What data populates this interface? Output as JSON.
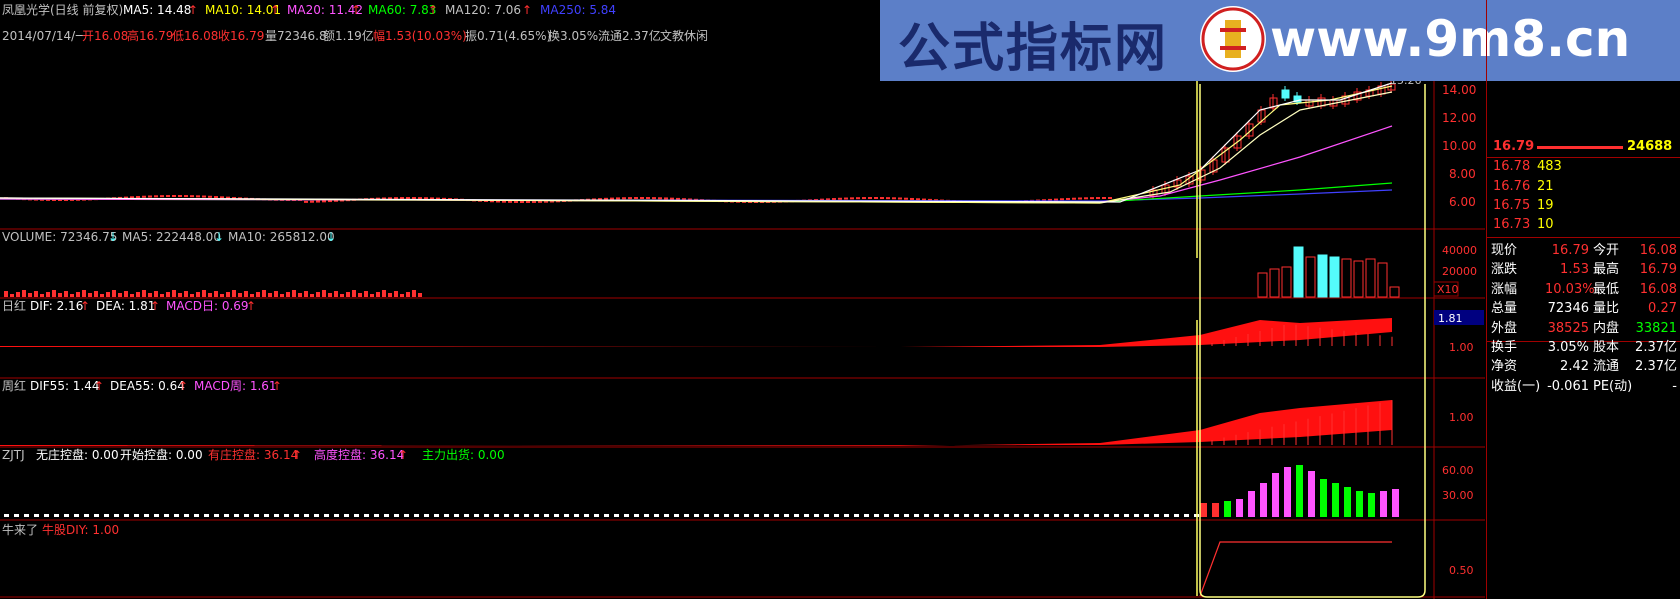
{
  "colors": {
    "up": "#ff3030",
    "down": "#54fcfc",
    "yellow": "#ffff00",
    "white": "#ffffff",
    "magenta": "#ff54ff",
    "green": "#00ff00",
    "grid": "#a00000",
    "gray": "#c0c0c0"
  },
  "header": {
    "stock": "凤凰光学(日线 前复权)",
    "ma5": "MA5: 14.48",
    "ma10": "MA10: 14.01",
    "ma20": "MA20: 11.42",
    "ma60": "MA60: 7.83",
    "ma120": "MA120: 7.06",
    "ma250": "MA250: 5.84",
    "date": "2014/07/14/一",
    "open": "开16.08",
    "high": "高16.79",
    "low": "低16.08",
    "close": "收16.79",
    "vol": "量72346.8",
    "amt": "额1.19亿",
    "chg": "幅1.53(10.03%)",
    "amp": "振0.71(4.65%)",
    "turn": "换3.05%",
    "float": "流通2.37亿",
    "sector": "文教休闲"
  },
  "watermark": {
    "cn": "公式指标网",
    "url": "www.9m8.cn"
  },
  "volume": {
    "label": "VOLUME: 72346.75",
    "ma5": "MA5: 222448.00",
    "ma10": "MA10: 265812.00"
  },
  "macd_day": {
    "name": "日红",
    "dif": "DIF: 2.16",
    "dea": "DEA: 1.81",
    "macd": "MACD日: 0.69"
  },
  "macd_week": {
    "name": "周红",
    "dif": "DIF55: 1.44",
    "dea": "DEA55: 0.64",
    "macd": "MACD周: 1.61"
  },
  "zjtj": {
    "name": "ZJTJ",
    "a": "无庄控盘: 0.00",
    "b": "开始控盘: 0.00",
    "c": "有庄控盘: 36.14",
    "d": "高度控盘: 36.14",
    "e": "主力出货: 0.00"
  },
  "niu": {
    "name": "牛来了",
    "v": "牛股DIY: 1.00"
  },
  "axis": {
    "price": [
      "14.00",
      "12.00",
      "10.00",
      "8.00",
      "6.00"
    ],
    "volume": [
      "40000",
      "20000",
      "X10"
    ],
    "macd_day": [
      "1.81",
      "1.00"
    ],
    "macd_week": [
      "1.00"
    ],
    "zjtj": [
      "60.00",
      "30.00"
    ],
    "niu": [
      "0.50"
    ],
    "price_tag": "15.26"
  },
  "quote": {
    "top_price": "16.79",
    "top_vol": "24688",
    "book": [
      {
        "p": "16.78",
        "v": "483"
      },
      {
        "p": "16.76",
        "v": "21"
      },
      {
        "p": "16.75",
        "v": "19"
      },
      {
        "p": "16.73",
        "v": "10"
      }
    ],
    "rows": [
      [
        "现价",
        "16.79",
        "今开",
        "16.08"
      ],
      [
        "涨跌",
        "1.53",
        "最高",
        "16.79"
      ],
      [
        "涨幅",
        "10.03%",
        "最低",
        "16.08"
      ],
      [
        "总量",
        "72346",
        "量比",
        "0.27"
      ],
      [
        "外盘",
        "38525",
        "内盘",
        "33821"
      ],
      [
        "换手",
        "3.05%",
        "股本",
        "2.37亿"
      ],
      [
        "净资",
        "2.42",
        "流通",
        "2.37亿"
      ],
      [
        "收益(一)",
        "-0.061",
        "PE(动)",
        "-"
      ]
    ]
  }
}
